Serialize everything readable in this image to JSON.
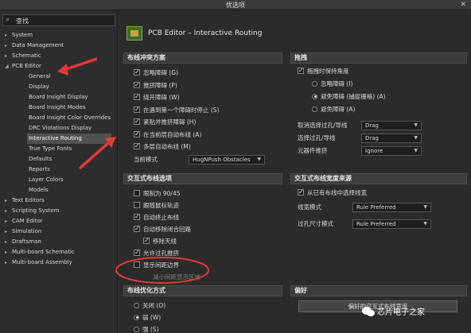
{
  "window": {
    "title": "优选项",
    "close_glyph": "✕"
  },
  "search": {
    "icon": "search-icon",
    "value": "查找"
  },
  "tree": [
    {
      "label": "System",
      "expander": "▸"
    },
    {
      "label": "Data Management",
      "expander": "▸"
    },
    {
      "label": "Schematic",
      "expander": "▸"
    },
    {
      "label": "PCB Editor",
      "expander": "◢"
    },
    {
      "label": "General"
    },
    {
      "label": "Display"
    },
    {
      "label": "Board Insight Display"
    },
    {
      "label": "Board Insight Modes"
    },
    {
      "label": "Board Insight Color Overrides"
    },
    {
      "label": "DRC Violations Display"
    },
    {
      "label": "Interactive Routing",
      "selected": true
    },
    {
      "label": "True Type Fonts"
    },
    {
      "label": "Defaults"
    },
    {
      "label": "Reports"
    },
    {
      "label": "Layer Colors"
    },
    {
      "label": "Models"
    },
    {
      "label": "Text Editors",
      "expander": "▸"
    },
    {
      "label": "Scripting System",
      "expander": "▸"
    },
    {
      "label": "CAM Editor",
      "expander": "▸"
    },
    {
      "label": "Simulation",
      "expander": "▸"
    },
    {
      "label": "Draftsman",
      "expander": "▸"
    },
    {
      "label": "Multi-board Schematic",
      "expander": "▸"
    },
    {
      "label": "Multi-board Assembly",
      "expander": "▸"
    }
  ],
  "header": {
    "title": "PCB Editor – Interactive Routing"
  },
  "conflict": {
    "title": "布线冲突方案",
    "options": [
      {
        "label": "忽略障碍 (G)",
        "checked": true
      },
      {
        "label": "推挤障碍 (P)",
        "checked": true
      },
      {
        "label": "绕开障碍 (W)",
        "checked": true
      },
      {
        "label": "在遇到第一个障碍时停止 (S)",
        "checked": true
      },
      {
        "label": "紧贴并推挤障碍 (H)",
        "checked": true
      },
      {
        "label": "在当前层自动布线 (A)",
        "checked": true
      },
      {
        "label": "多层自动布线 (M)",
        "checked": true
      }
    ],
    "mode_label": "当前模式",
    "mode_value": "HugNPush Obstacles"
  },
  "drag": {
    "title": "拖拽",
    "keep_angle": "拖拽时保持角度",
    "radios": [
      {
        "label": "忽略障碍 (I)",
        "on": false
      },
      {
        "label": "避免障碍 (捕捉栅格) (A)",
        "on": true
      },
      {
        "label": "避免障碍 (A)",
        "on": false
      }
    ],
    "rows": [
      {
        "label": "取消选择过孔/导线",
        "value": "Drag"
      },
      {
        "label": "选择过孔/导线",
        "value": "Drag"
      },
      {
        "label": "元器件推挤",
        "value": "Ignore"
      }
    ]
  },
  "interactive": {
    "title": "交互式布线选项",
    "options": [
      {
        "label": "限制为 90/45",
        "checked": false,
        "indent": 0
      },
      {
        "label": "跟随鼠标轨迹",
        "checked": false,
        "indent": 0
      },
      {
        "label": "自动终止布线",
        "checked": true,
        "indent": 0
      },
      {
        "label": "自动移除闭合回路",
        "checked": true,
        "indent": 0
      },
      {
        "label": "移除天线",
        "checked": true,
        "indent": 1
      },
      {
        "label": "允许过孔推挤",
        "checked": true,
        "indent": 0
      },
      {
        "label": "显示间距边界",
        "checked": false,
        "indent": 0
      },
      {
        "label": "减小间距显示区域",
        "checked": false,
        "indent": 1,
        "disabled": true
      }
    ]
  },
  "width": {
    "title": "交互式布线宽度来源",
    "pick_from_existing": "从已有布线中选择线宽",
    "rows": [
      {
        "label": "线宽模式",
        "value": "Rule Preferred"
      },
      {
        "label": "过孔尺寸模式",
        "value": "Rule Preferred"
      }
    ]
  },
  "optimize": {
    "title": "布线优化方式",
    "radios": [
      {
        "label": "关闭 (O)",
        "on": false
      },
      {
        "label": "弱 (W)",
        "on": true
      },
      {
        "label": "强 (S)",
        "on": false
      }
    ]
  },
  "prefs": {
    "title": "偏好",
    "button": "偏好的交互式布线宽度"
  },
  "watermark": {
    "text": "芯片电子之家"
  }
}
